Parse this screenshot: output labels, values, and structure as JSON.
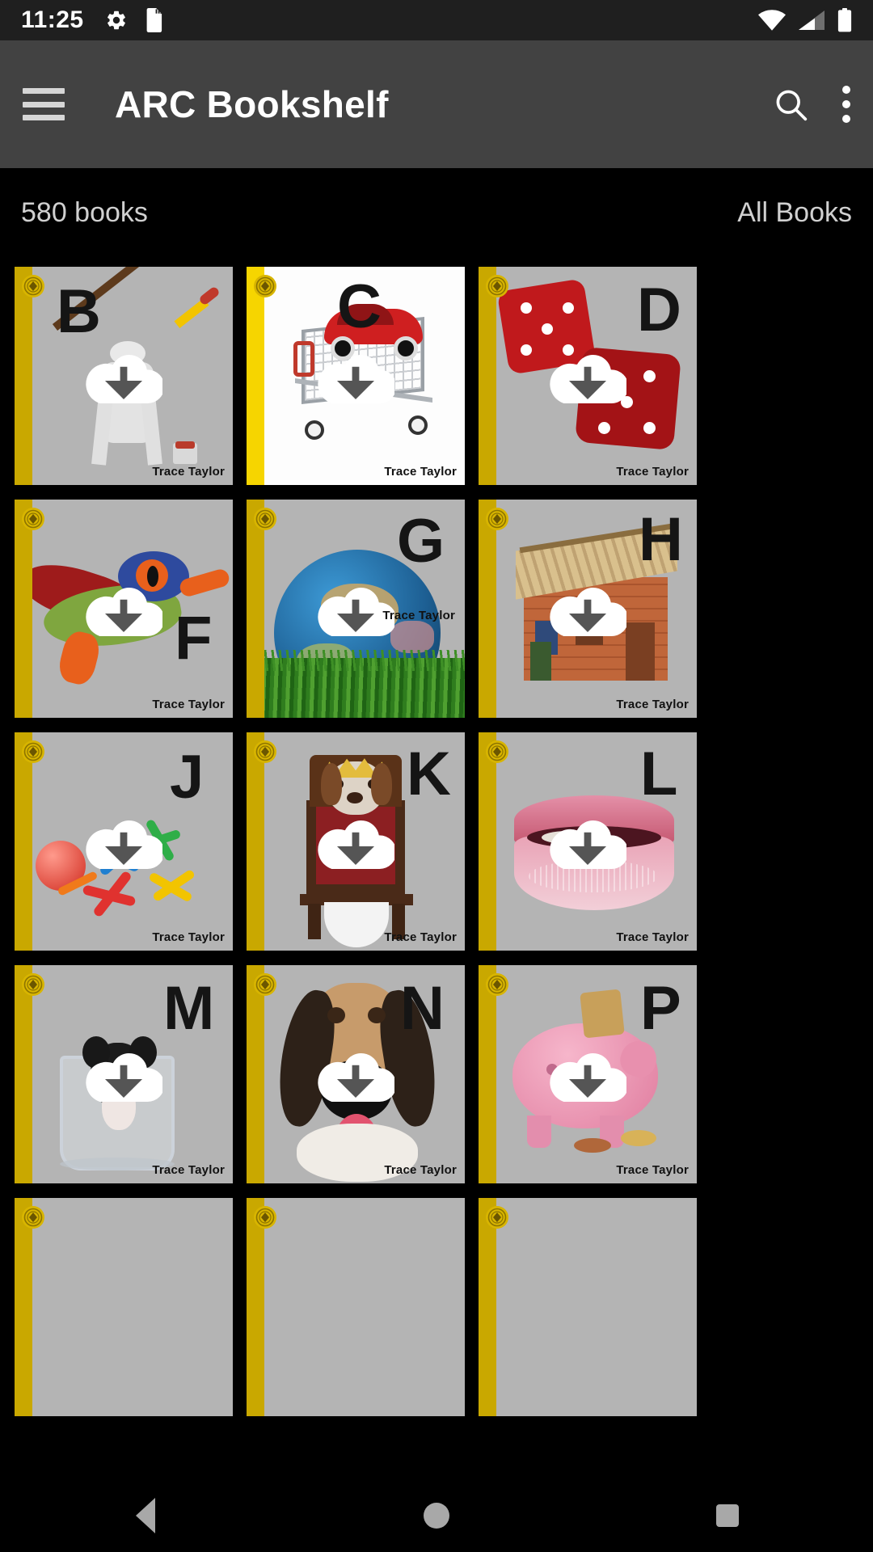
{
  "status_bar": {
    "time": "11:25",
    "left_icons": [
      "gear-icon",
      "sd-card-icon"
    ],
    "right_icons": [
      "wifi-icon",
      "cell-signal-icon",
      "battery-icon"
    ]
  },
  "app_bar": {
    "menu_icon": "hamburger-menu-icon",
    "title": "ARC Bookshelf",
    "search_icon": "search-icon",
    "overflow_icon": "more-vertical-icon"
  },
  "subheader": {
    "count": "580 books",
    "filter": "All Books"
  },
  "colors": {
    "app_bar": "#424242",
    "background": "#000000",
    "spine_gold": "#c9a800",
    "spine_bright": "#f6d500",
    "cover_gray": "#b4b4b4",
    "seal_gold": "#d8b500"
  },
  "grid": {
    "columns": 3,
    "books": [
      {
        "letter": "B",
        "author": "Trace Taylor",
        "subject": "artist mannequin with paintbrush",
        "cover": "gray",
        "spine": "gold",
        "download_state": "cloud-download-icon"
      },
      {
        "letter": "C",
        "author": "Trace Taylor",
        "subject": "red car in shopping cart",
        "cover": "white",
        "spine": "bright",
        "download_state": "cloud-download-icon"
      },
      {
        "letter": "D",
        "author": "Trace Taylor",
        "subject": "red dice",
        "cover": "gray",
        "spine": "gold",
        "download_state": "cloud-download-icon"
      },
      {
        "letter": "F",
        "author": "Trace Taylor",
        "subject": "red-eyed tree frog",
        "cover": "gray",
        "spine": "gold",
        "download_state": "cloud-download-icon"
      },
      {
        "letter": "G",
        "author": "Trace Taylor",
        "subject": "globe in grass",
        "cover": "gray",
        "spine": "gold",
        "download_state": "cloud-download-icon"
      },
      {
        "letter": "H",
        "author": "Trace Taylor",
        "subject": "brick house under construction",
        "cover": "gray",
        "spine": "gold",
        "download_state": "cloud-download-icon"
      },
      {
        "letter": "J",
        "author": "Trace Taylor",
        "subject": "colorful jacks toys",
        "cover": "gray",
        "spine": "gold",
        "download_state": "cloud-download-icon"
      },
      {
        "letter": "K",
        "author": "Trace Taylor",
        "subject": "dog king on throne",
        "cover": "gray",
        "spine": "gold",
        "download_state": "cloud-download-icon"
      },
      {
        "letter": "L",
        "author": "Trace Taylor",
        "subject": "pink lips",
        "cover": "gray",
        "spine": "gold",
        "download_state": "cloud-download-icon"
      },
      {
        "letter": "M",
        "author": "Trace Taylor",
        "subject": "mouse in glass",
        "cover": "gray",
        "spine": "gold",
        "download_state": "cloud-download-icon"
      },
      {
        "letter": "N",
        "author": "Trace Taylor",
        "subject": "dog nose close-up",
        "cover": "gray",
        "spine": "gold",
        "download_state": "cloud-download-icon"
      },
      {
        "letter": "P",
        "author": "Trace Taylor",
        "subject": "pink piggy bank with coins",
        "cover": "gray",
        "spine": "gold",
        "download_state": "cloud-download-icon"
      },
      {
        "letter": "",
        "author": "",
        "subject": "partially visible row",
        "cover": "gray",
        "spine": "gold",
        "download_state": ""
      },
      {
        "letter": "",
        "author": "",
        "subject": "partially visible row",
        "cover": "gray",
        "spine": "gold",
        "download_state": ""
      },
      {
        "letter": "",
        "author": "",
        "subject": "partially visible row",
        "cover": "gray",
        "spine": "gold",
        "download_state": ""
      }
    ]
  },
  "nav_bar": {
    "back": "back-triangle-icon",
    "home": "home-circle-icon",
    "recents": "recents-square-icon"
  }
}
